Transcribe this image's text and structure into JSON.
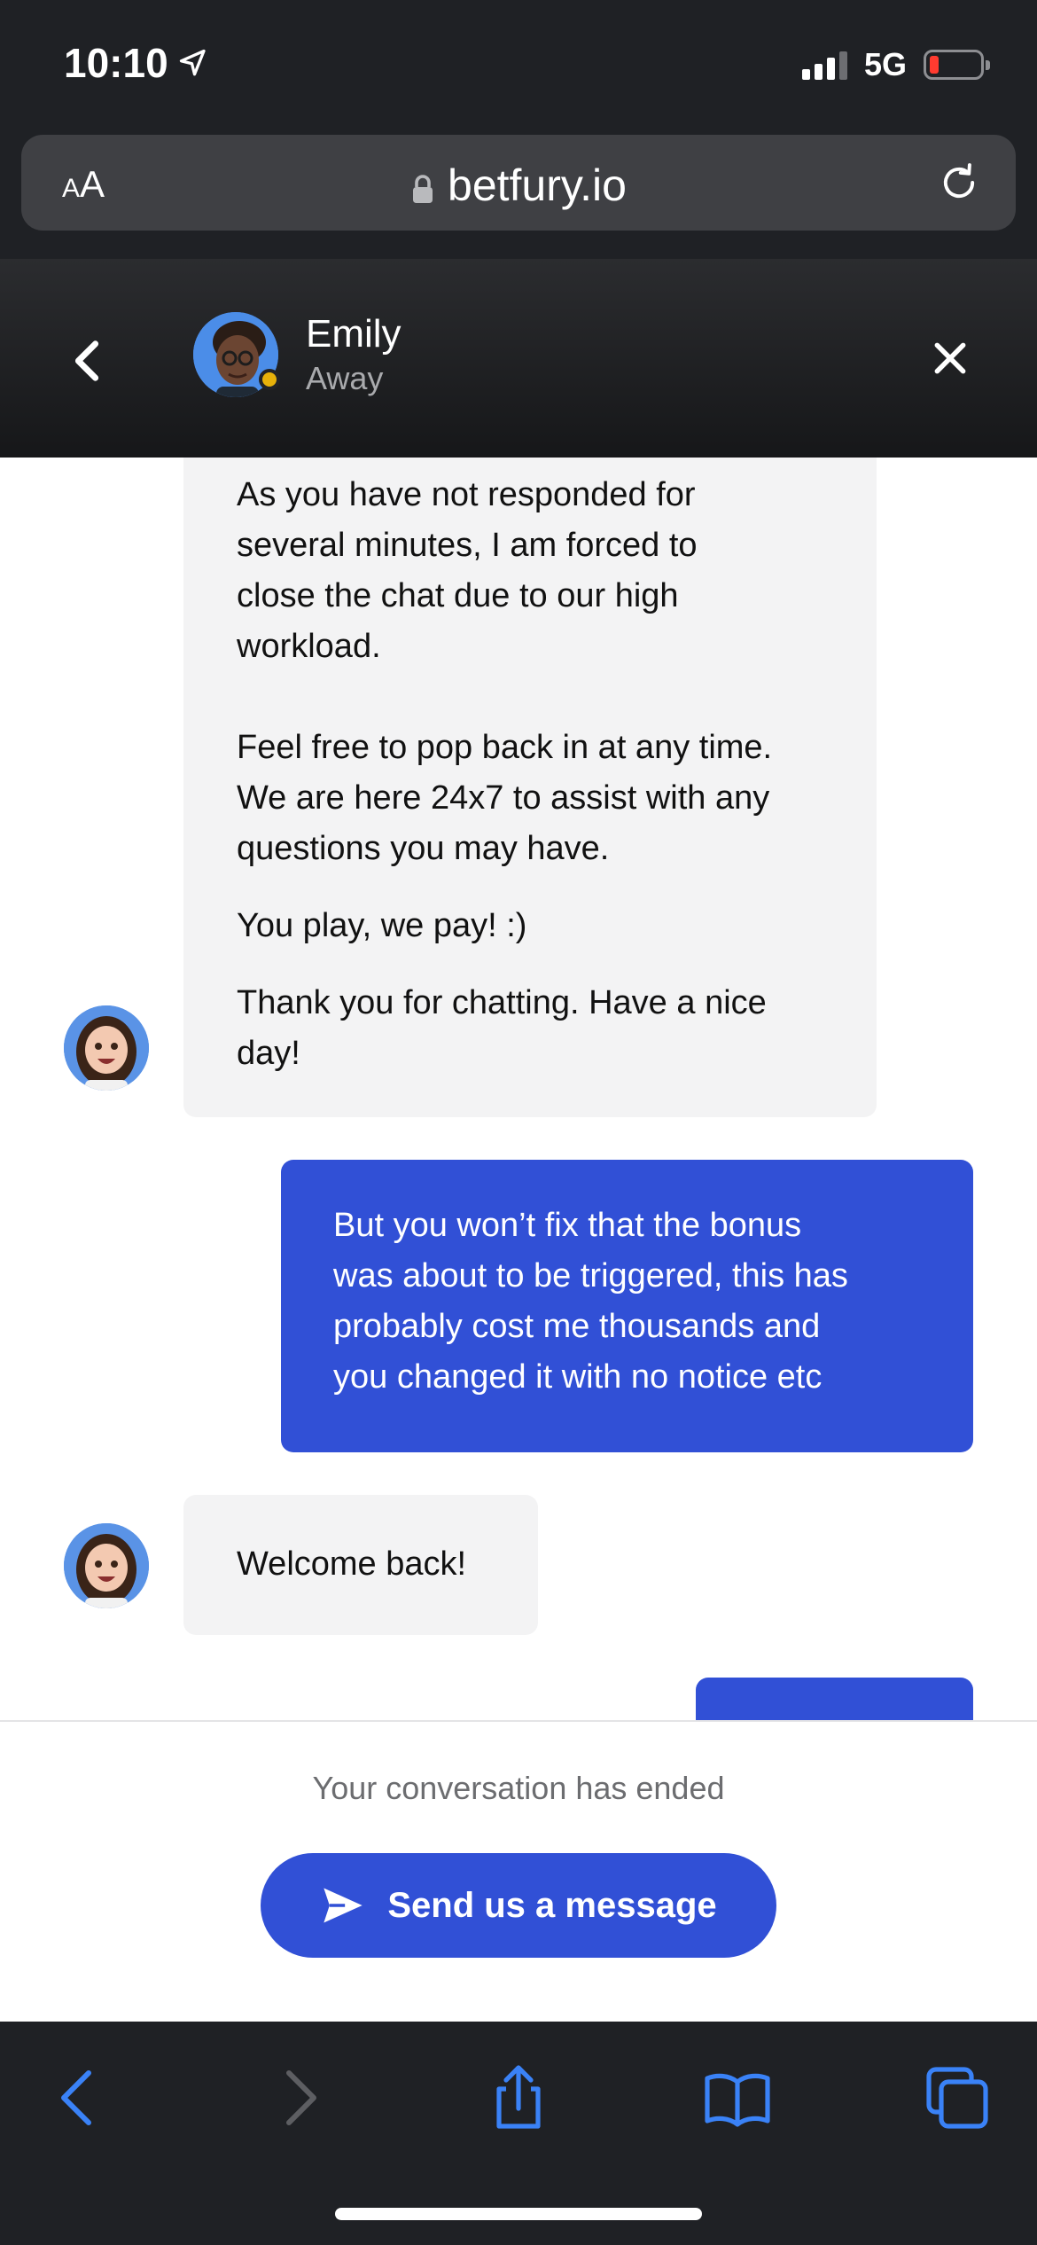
{
  "status_bar": {
    "time": "10:10",
    "network": "5G",
    "location_icon": "location-arrow-icon",
    "battery_level_fraction": 0.12
  },
  "browser": {
    "text_size_label_small": "A",
    "text_size_label_large": "A",
    "url": "betfury.io",
    "icons": [
      "lock-icon",
      "reload-icon"
    ]
  },
  "chat_header": {
    "agent_name": "Emily",
    "agent_status": "Away",
    "icons": [
      "chevron-left-icon",
      "close-icon"
    ]
  },
  "messages": [
    {
      "direction": "incoming",
      "paragraphs": [
        "As you have not responded for\nseveral minutes, I am forced to\nclose the chat due to our high\nworkload.\n\nFeel free to pop back in at any time.\nWe are here 24x7 to assist with any\nquestions you may have.",
        "You play, we pay! :)",
        "Thank you for chatting. Have a nice\nday!"
      ]
    },
    {
      "direction": "outgoing",
      "text": "But you won’t fix that the bonus\nwas about to be triggered, this has\nprobably cost me thousands and\nyou changed it with no notice etc"
    },
    {
      "direction": "incoming",
      "text": "Welcome back!"
    },
    {
      "direction": "outgoing",
      "text": ""
    }
  ],
  "footer": {
    "ended_text": "Your conversation has ended",
    "send_button_label": "Send us a message"
  },
  "toolbar": {
    "icons": [
      "back-icon",
      "forward-icon",
      "share-icon",
      "bookmarks-icon",
      "tabs-icon"
    ]
  },
  "colors": {
    "accent": "#3150d6",
    "incoming_bubble": "#f3f3f4",
    "dark_chrome": "#1f2125",
    "away_status": "#e7b10a"
  }
}
